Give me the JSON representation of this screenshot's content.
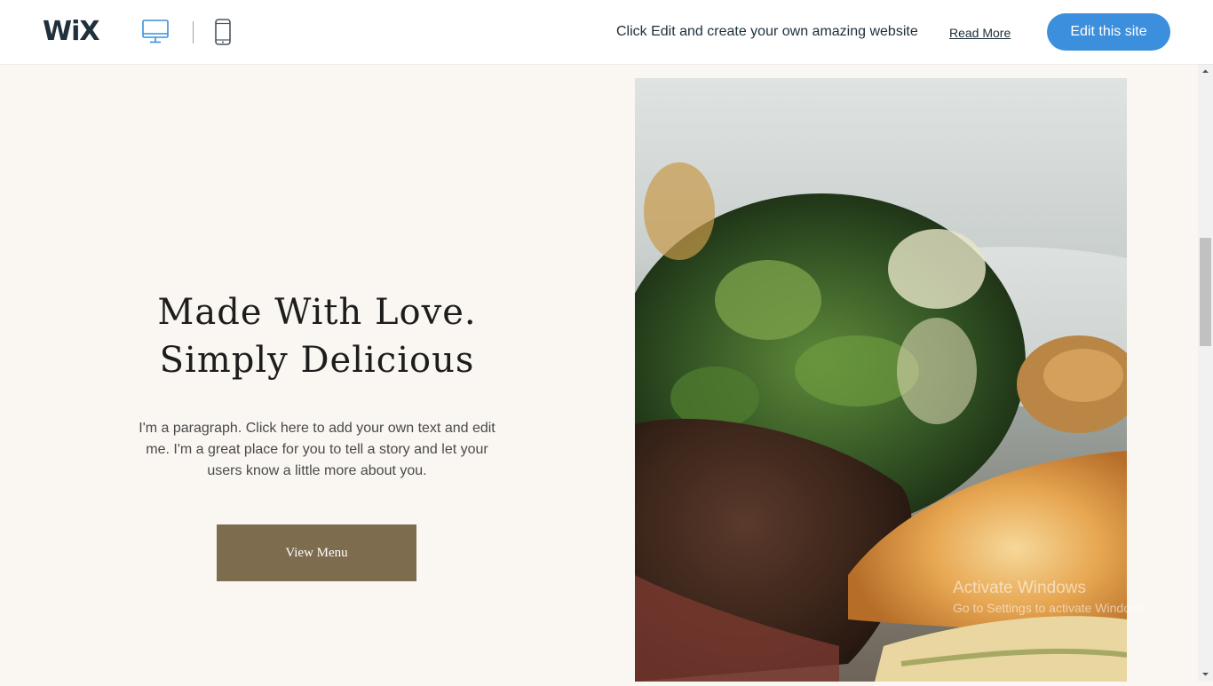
{
  "topbar": {
    "logo_text": "WiX",
    "device_desktop_icon": "desktop-monitor-icon",
    "device_mobile_icon": "mobile-phone-icon",
    "promo_text": "Click Edit and create your own amazing website",
    "read_more_label": "Read More",
    "edit_button_label": "Edit this site",
    "accent_color": "#3b8fdd"
  },
  "hero": {
    "title_line1": "Made With Love.",
    "title_line2": "Simply Delicious",
    "paragraph": "I'm a paragraph. Click here to add your own text and edit me. I'm a great place for you to tell a story and let your users know a little more about you.",
    "button_label": "View Menu",
    "button_color": "#7d6c4e",
    "background_color": "#faf7f2"
  },
  "windows_watermark": {
    "title": "Activate Windows",
    "subtitle": "Go to Settings to activate Windows."
  },
  "scrollbar": {
    "up_icon": "arrow-up-icon",
    "down_icon": "arrow-down-icon"
  }
}
